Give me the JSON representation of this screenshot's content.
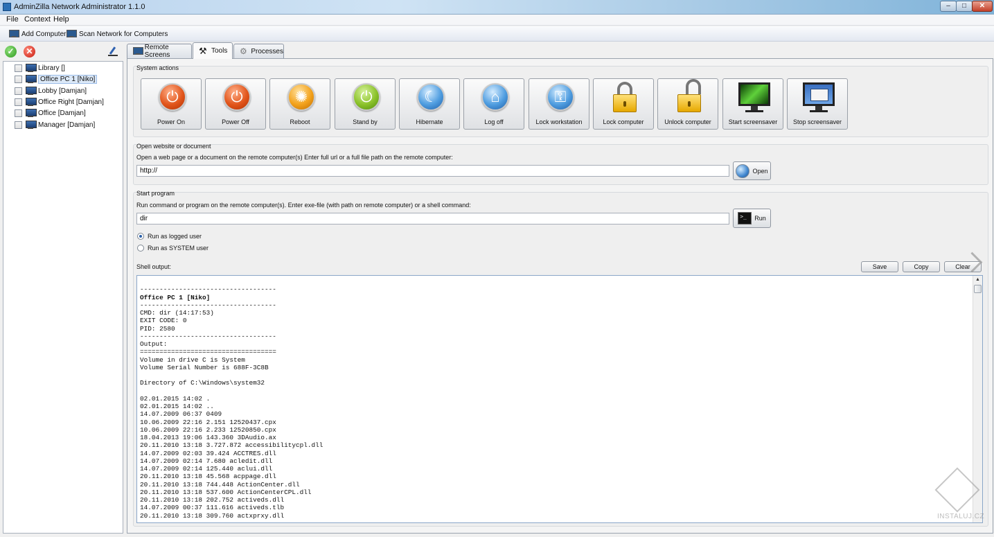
{
  "window": {
    "title": "AdminZilla Network Administrator 1.1.0",
    "min_label": "–",
    "max_label": "□",
    "close_label": "✕"
  },
  "menu": {
    "file": "File",
    "context": "Context",
    "help": "Help"
  },
  "toolbar": {
    "add_computer": "Add Computer",
    "scan_network": "Scan Network for Computers"
  },
  "left_panel": {
    "ok_label": "✓",
    "cancel_label": "✕",
    "computers": [
      {
        "label": "Library []",
        "selected": false
      },
      {
        "label": "Office PC 1 [Niko]",
        "selected": true
      },
      {
        "label": "Lobby [Damjan]",
        "selected": false
      },
      {
        "label": "Office Right [Damjan]",
        "selected": false
      },
      {
        "label": "Office [Damjan]",
        "selected": false
      },
      {
        "label": "Manager [Damjan]",
        "selected": false
      }
    ]
  },
  "tabs": {
    "remote_screens": "Remote Screens",
    "tools": "Tools",
    "processes": "Processes",
    "active": "Tools"
  },
  "system_actions": {
    "title": "System actions",
    "buttons": [
      {
        "label": "Power On",
        "icon": "power-icon"
      },
      {
        "label": "Power Off",
        "icon": "power-icon"
      },
      {
        "label": "Reboot",
        "icon": "sunburst-icon"
      },
      {
        "label": "Stand by",
        "icon": "power-icon"
      },
      {
        "label": "Hibernate",
        "icon": "moon-icon"
      },
      {
        "label": "Log off",
        "icon": "home-icon"
      },
      {
        "label": "Lock workstation",
        "icon": "key-icon"
      },
      {
        "label": "Lock computer",
        "icon": "padlock-closed-icon"
      },
      {
        "label": "Unlock computer",
        "icon": "padlock-open-icon"
      },
      {
        "label": "Start screensaver",
        "icon": "monitor-screensaver-icon"
      },
      {
        "label": "Stop screensaver",
        "icon": "monitor-desktop-icon"
      }
    ]
  },
  "open_website": {
    "title": "Open website or document",
    "description": "Open a web page or a document on the remote computer(s) Enter full url or a full file path on the remote computer:",
    "value": "http://",
    "button": "Open"
  },
  "start_program": {
    "title": "Start program",
    "description": "Run command or program on the remote computer(s). Enter exe-file (with path on remote computer) or a shell command:",
    "value": "dir",
    "button": "Run",
    "run_as_logged": "Run as logged user",
    "run_as_system": "Run as SYSTEM user",
    "selected_mode": "logged"
  },
  "shell_output": {
    "title": "Shell output:",
    "save": "Save",
    "copy": "Copy",
    "clear": "Clear",
    "lines": [
      "",
      "-----------------------------------",
      "Office PC 1 [Niko]",
      "-----------------------------------",
      "CMD: dir (14:17:53)",
      "EXIT CODE: 0",
      "PID: 2580",
      "-----------------------------------",
      "Output:",
      "===================================",
      "Volume in drive C is System",
      "Volume Serial Number is 688F-3C8B",
      "",
      "Directory of C:\\Windows\\system32",
      "",
      "02.01.2015 14:02 .",
      "02.01.2015 14:02 ..",
      "14.07.2009 06:37 0409",
      "10.06.2009 22:16 2.151 12520437.cpx",
      "10.06.2009 22:16 2.233 12520850.cpx",
      "18.04.2013 19:06 143.360 3DAudio.ax",
      "20.11.2010 13:18 3.727.872 accessibilitycpl.dll",
      "14.07.2009 02:03 39.424 ACCTRES.dll",
      "14.07.2009 02:14 7.680 acledit.dll",
      "14.07.2009 02:14 125.440 aclui.dll",
      "20.11.2010 13:18 45.568 acppage.dll",
      "20.11.2010 13:18 744.448 ActionCenter.dll",
      "20.11.2010 13:18 537.600 ActionCenterCPL.dll",
      "20.11.2010 13:18 202.752 activeds.dll",
      "14.07.2009 00:37 111.616 activeds.tlb",
      "20.11.2010 13:18 309.760 actxprxy.dll"
    ]
  },
  "scroll_up_glyph": "▲",
  "watermark": "INSTALUJ.CZ"
}
